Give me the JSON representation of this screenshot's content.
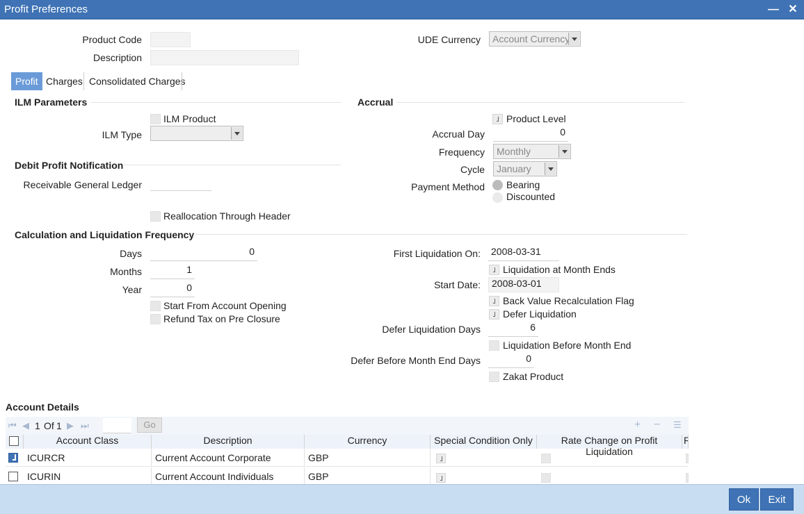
{
  "window": {
    "title": "Profit Preferences"
  },
  "header": {
    "product_code_label": "Product Code",
    "product_code_value": "",
    "description_label": "Description",
    "description_value": "",
    "ude_currency_label": "UDE Currency",
    "ude_currency_value": "Account Currency"
  },
  "tabs": [
    "Profit",
    "Charges",
    "Consolidated Charges"
  ],
  "ilm": {
    "title": "ILM Parameters",
    "ilm_product_label": "ILM Product",
    "ilm_type_label": "ILM Type",
    "ilm_type_value": ""
  },
  "debit_notification": {
    "title": "Debit Profit Notification",
    "receivable_gl_label": "Receivable General Ledger",
    "receivable_gl_value": "",
    "reallocation_label": "Reallocation Through Header"
  },
  "accrual": {
    "title": "Accrual",
    "product_level_label": "Product Level",
    "accrual_day_label": "Accrual Day",
    "accrual_day_value": "0",
    "frequency_label": "Frequency",
    "frequency_value": "Monthly",
    "cycle_label": "Cycle",
    "cycle_value": "January",
    "payment_method_label": "Payment Method",
    "bearing_label": "Bearing",
    "discounted_label": "Discounted"
  },
  "calc": {
    "title": "Calculation and Liquidation Frequency",
    "days_label": "Days",
    "days_value": "0",
    "months_label": "Months",
    "months_value": "1",
    "year_label": "Year",
    "year_value": "0",
    "start_from_opening_label": "Start From Account Opening",
    "refund_tax_label": "Refund Tax on Pre Closure",
    "first_liq_label": "First Liquidation On:",
    "first_liq_value": "2008-03-31",
    "liq_month_ends_label": "Liquidation at Month Ends",
    "start_date_label": "Start Date:",
    "start_date_value": "2008-03-01",
    "back_value_label": "Back Value Recalculation Flag",
    "defer_liq_label": "Defer Liquidation",
    "defer_liq_days_label": "Defer Liquidation Days",
    "defer_liq_days_value": "6",
    "liq_before_month_end_label": "Liquidation Before Month End",
    "defer_before_month_end_label": "Defer Before Month End Days",
    "defer_before_month_end_value": "0",
    "zakat_label": "Zakat Product"
  },
  "account_details": {
    "title": "Account Details",
    "pager": {
      "current": "1",
      "of_label": "Of",
      "total": "1",
      "go_label": "Go"
    },
    "columns": [
      "Account Class",
      "Description",
      "Currency",
      "Special Condition Only",
      "Rate Change on Profit Liquidation",
      "R"
    ],
    "rows": [
      {
        "account_class": "ICURCR",
        "description": "Current Account Corporate",
        "currency": "GBP"
      },
      {
        "account_class": "ICURIN",
        "description": "Current Account Individuals",
        "currency": "GBP"
      }
    ]
  },
  "footer": {
    "ok_label": "Ok",
    "exit_label": "Exit"
  }
}
